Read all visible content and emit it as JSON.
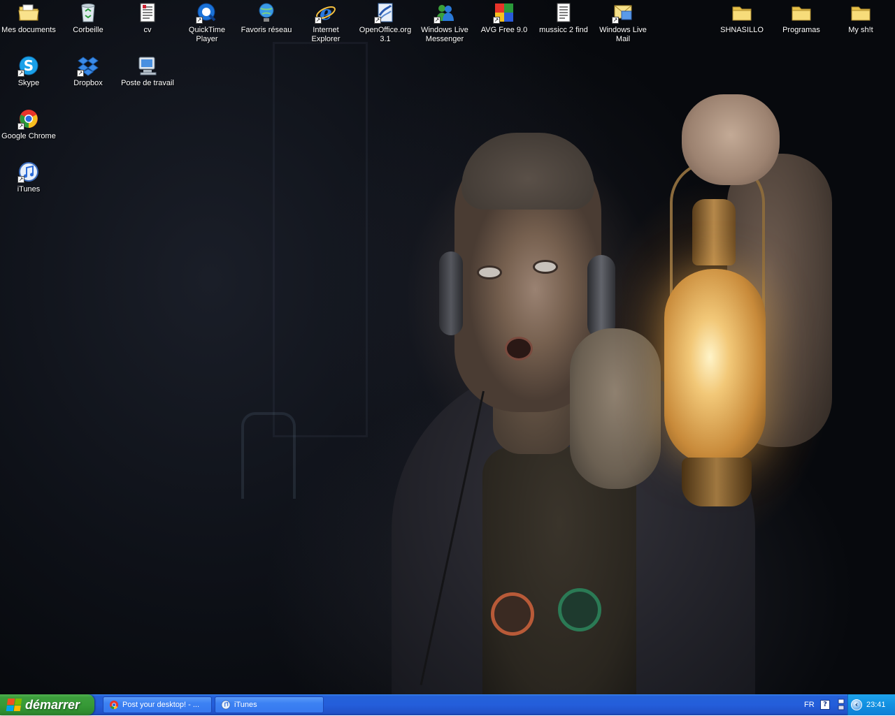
{
  "desktop": {
    "icons": [
      {
        "label": "Mes documents",
        "icon": "documents-folder-icon"
      },
      {
        "label": "Corbeille",
        "icon": "recycle-bin-icon"
      },
      {
        "label": "cv",
        "icon": "text-document-icon"
      },
      {
        "label": "QuickTime Player",
        "icon": "quicktime-icon"
      },
      {
        "label": "Favoris réseau",
        "icon": "network-places-icon"
      },
      {
        "label": "Internet\nExplorer",
        "icon": "internet-explorer-icon"
      },
      {
        "label": "OpenOffice.org\n3.1",
        "icon": "openoffice-icon"
      },
      {
        "label": "Windows Live\nMessenger",
        "icon": "messenger-icon"
      },
      {
        "label": "AVG Free 9.0",
        "icon": "avg-icon"
      },
      {
        "label": "mussicc 2 find",
        "icon": "text-document-icon"
      },
      {
        "label": "Windows Live\nMail",
        "icon": "mail-icon"
      },
      {
        "label": "SHNASILLO",
        "icon": "folder-icon"
      },
      {
        "label": "Programas",
        "icon": "folder-icon"
      },
      {
        "label": "My  sh!t",
        "icon": "folder-icon"
      },
      {
        "label": "Skype",
        "icon": "skype-icon"
      },
      {
        "label": "Dropbox",
        "icon": "dropbox-icon"
      },
      {
        "label": "Poste de travail",
        "icon": "my-computer-icon"
      },
      {
        "label": "Google Chrome",
        "icon": "chrome-icon"
      },
      {
        "label": "iTunes",
        "icon": "itunes-icon"
      }
    ]
  },
  "taskbar": {
    "start_label": "démarrer",
    "tasks": [
      {
        "label": "Post your desktop! - ...",
        "icon": "chrome-icon"
      },
      {
        "label": "iTunes",
        "icon": "itunes-icon"
      }
    ],
    "tray": {
      "language": "FR",
      "help": "?",
      "expand": "‹",
      "clock": "23:41"
    }
  },
  "colors": {
    "taskbar_blue": "#245edb",
    "start_green": "#379a37",
    "tray_blue": "#1290e1"
  }
}
